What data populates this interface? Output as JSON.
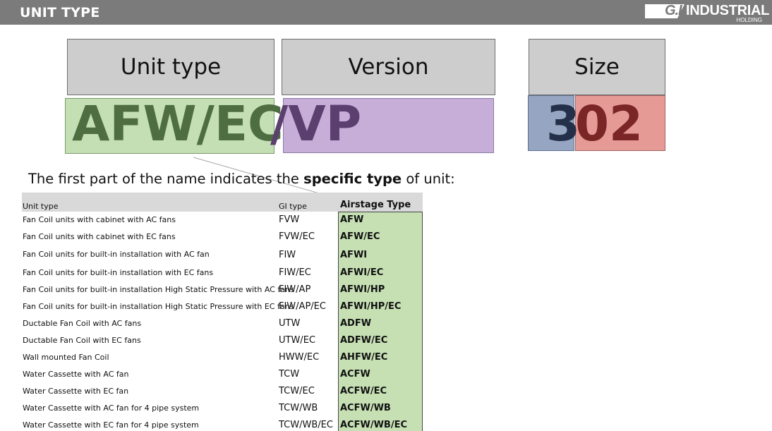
{
  "header": {
    "title": "UNIT TYPE",
    "logo": {
      "mark": "G.I.",
      "name": "INDUSTRIAL",
      "sub": "HOLDING"
    }
  },
  "diagram": {
    "unit_type_label": "Unit type",
    "version_label": "Version",
    "size_label": "Size",
    "unit_code": "AFW/EC",
    "version_code": "/VP",
    "size_first": "3",
    "size_rest": "02",
    "colors": {
      "unit_box": "#c5dfb4",
      "unit_text": "#4e6e42",
      "version_box": "#c6aed9",
      "version_text": "#5b3f6e",
      "size_first_box": "#96a6c2",
      "size_first_text": "#24304a",
      "size_rest_box": "#e69a96",
      "size_rest_text": "#7a2526"
    }
  },
  "intro": {
    "before": "The first part of the name indicates the ",
    "bold": "specific type",
    "after": " of unit:"
  },
  "table": {
    "headers": [
      "Unit type",
      "GI type",
      "Airstage Type"
    ],
    "rows": [
      [
        "Fan Coil units with cabinet with AC fans",
        "FVW",
        "AFW"
      ],
      [
        "Fan Coil units with cabinet with EC fans",
        "FVW/EC",
        "AFW/EC"
      ],
      [
        "Fan Coil units for built-in installation with AC fan",
        "FIW",
        "AFWI"
      ],
      [
        "Fan Coil units for built-in installation with EC fans",
        "FIW/EC",
        "AFWI/EC"
      ],
      [
        "Fan Coil units for built-in installation High Static Pressure  with AC fans",
        "FIW/AP",
        "AFWI/HP"
      ],
      [
        "Fan Coil units for built-in installation High Static Pressure with EC fans",
        "FIW/AP/EC",
        "AFWI/HP/EC"
      ],
      [
        "Ductable Fan Coil with AC fans",
        "UTW",
        "ADFW"
      ],
      [
        "Ductable Fan Coil with EC fans",
        "UTW/EC",
        "ADFW/EC"
      ],
      [
        "Wall mounted Fan Coil",
        "HWW/EC",
        "AHFW/EC"
      ],
      [
        "Water Cassette with AC fan",
        "TCW",
        "ACFW"
      ],
      [
        "Water Cassette with EC fan",
        "TCW/EC",
        "ACFW/EC"
      ],
      [
        "Water Cassette with AC fan for 4 pipe system",
        "TCW/WB",
        "ACFW/WB"
      ],
      [
        "Water Cassette with EC fan for 4 pipe system",
        "TCW/WB/EC",
        "ACFW/WB/EC"
      ]
    ]
  }
}
